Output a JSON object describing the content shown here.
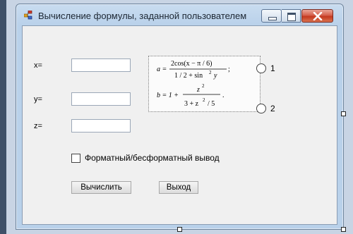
{
  "window": {
    "title": "Вычисление формулы, заданной пользователем",
    "icons": {
      "app": "app-form-icon",
      "minimize": "minimize-icon",
      "maximize": "maximize-icon",
      "close": "close-icon"
    },
    "close_color": "#c4381f"
  },
  "form": {
    "x_label": "x=",
    "y_label": "y=",
    "z_label": "z=",
    "x_value": "",
    "y_value": "",
    "z_value": "",
    "formula_a": {
      "lhs": "a =",
      "numerator": "2cos(x − π / 6)",
      "denominator_left": "1 / 2 + sin",
      "denominator_exp": "2",
      "denominator_right": "y",
      "tail": ";"
    },
    "formula_b": {
      "lhs": "b = 1 +",
      "numerator_base": "z",
      "numerator_exp": "2",
      "denominator_left": "3 + z",
      "denominator_exp": "2",
      "denominator_right": "/ 5",
      "tail": "."
    },
    "radio_1_label": "1",
    "radio_2_label": "2",
    "checkbox_label": "Форматный/бесформатный вывод",
    "calculate_label": "Вычислить",
    "exit_label": "Выход"
  }
}
